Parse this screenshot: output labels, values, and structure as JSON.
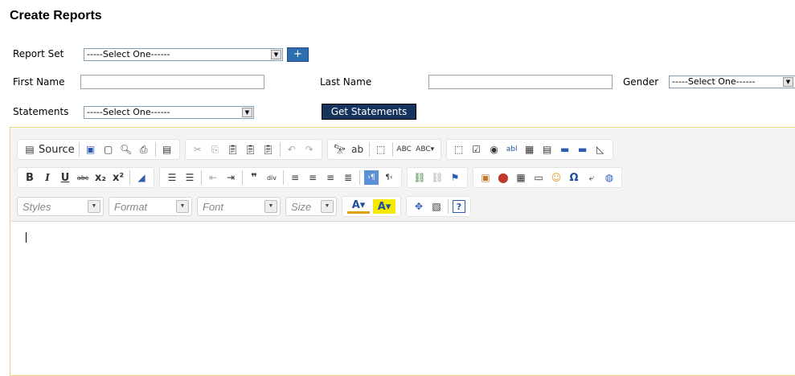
{
  "page": {
    "title": "Create Reports"
  },
  "form": {
    "report_set_label": "Report Set",
    "report_set_value": "-----Select One------",
    "add_button": "+",
    "first_name_label": "First Name",
    "first_name_value": "",
    "last_name_label": "Last Name",
    "last_name_value": "",
    "gender_label": "Gender",
    "gender_value": "-----Select One------",
    "statements_label": "Statements",
    "statements_value": "-----Select One------",
    "get_statements_button": "Get Statements"
  },
  "editor": {
    "source_label": "Source",
    "styles": "Styles",
    "format": "Format",
    "font": "Font",
    "size": "Size",
    "body_text": ""
  },
  "icons": {
    "row1": [
      "save-icon",
      "new-page-icon",
      "preview-icon",
      "print-icon",
      "templates-icon",
      "cut-icon",
      "copy-icon",
      "paste-icon",
      "paste-text-icon",
      "paste-word-icon",
      "undo-icon",
      "redo-icon",
      "find-icon",
      "replace-icon",
      "select-all-icon",
      "spell-check-icon",
      "spell-check-as-you-type-icon",
      "form-icon",
      "checkbox-icon",
      "radio-icon",
      "text-field-icon",
      "textarea-icon",
      "select-field-icon",
      "button-icon",
      "image-button-icon",
      "hidden-field-icon"
    ],
    "row2": [
      "bold-icon",
      "italic-icon",
      "underline-icon",
      "strike-icon",
      "subscript-icon",
      "superscript-icon",
      "remove-format-icon",
      "numbered-list-icon",
      "bulleted-list-icon",
      "outdent-icon",
      "indent-icon",
      "blockquote-icon",
      "create-div-icon",
      "align-left-icon",
      "align-center-icon",
      "align-right-icon",
      "justify-icon",
      "ltr-icon",
      "rtl-icon",
      "link-icon",
      "unlink-icon",
      "anchor-icon",
      "image-icon",
      "flash-icon",
      "table-icon",
      "horizontal-rule-icon",
      "smiley-icon",
      "special-char-icon",
      "page-break-icon",
      "iframe-icon"
    ],
    "row3": [
      "text-color-icon",
      "bg-color-icon",
      "maximize-icon",
      "show-blocks-icon",
      "about-icon"
    ]
  }
}
